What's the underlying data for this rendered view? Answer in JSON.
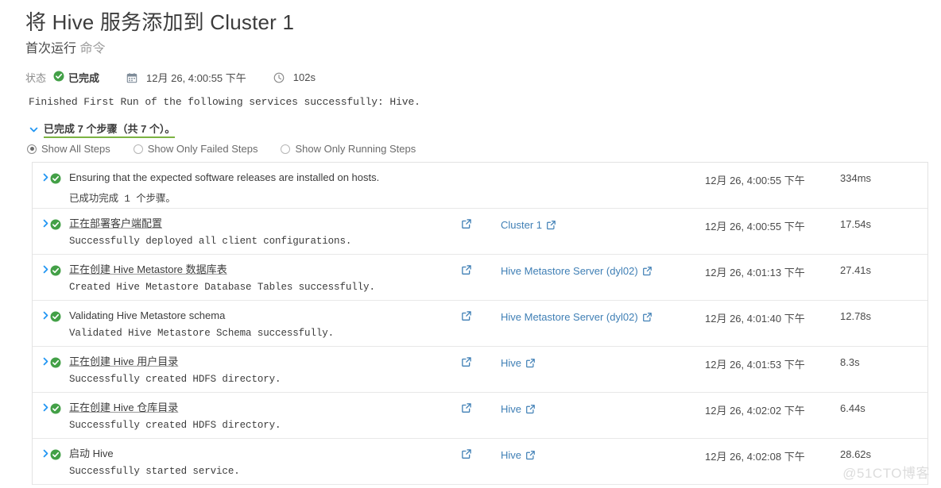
{
  "header": {
    "title": "将 Hive 服务添加到 Cluster 1",
    "subtitle_main": "首次运行",
    "subtitle_muted": "命令"
  },
  "status": {
    "label": "状态",
    "value": "已完成",
    "status_icon": "check-circle-icon",
    "calendar_icon": "calendar-icon",
    "timestamp": "12月 26, 4:00:55 下午",
    "clock_icon": "clock-icon",
    "duration": "102s",
    "status_color": "#43a047"
  },
  "run_message": "Finished First Run of the following services successfully: Hive.",
  "summary": {
    "toggle_icon": "chevron-down-icon",
    "text": "已完成 7 个步骤（共 7 个）。",
    "underline_color": "#7cb342"
  },
  "filters": [
    {
      "label": "Show All Steps",
      "selected": true
    },
    {
      "label": "Show Only Failed Steps",
      "selected": false
    },
    {
      "label": "Show Only Running Steps",
      "selected": false
    }
  ],
  "steps": [
    {
      "toggle_icon": "chevron-right-icon",
      "state_icon": "check-circle-icon",
      "title": "Ensuring that the expected software releases are installed on hosts.",
      "title_is_link": false,
      "detail": "已成功完成 1 个步骤。",
      "link_icon": "",
      "link_label": "",
      "time": "12月 26, 4:00:55 下午",
      "duration": "334ms"
    },
    {
      "toggle_icon": "chevron-right-icon",
      "state_icon": "check-circle-icon",
      "title": "正在部署客户端配置",
      "title_is_link": true,
      "detail": "Successfully deployed all client configurations.",
      "link_icon": "external-link-icon",
      "link_label": "Cluster 1",
      "time": "12月 26, 4:00:55 下午",
      "duration": "17.54s"
    },
    {
      "toggle_icon": "chevron-right-icon",
      "state_icon": "check-circle-icon",
      "title": "正在创建 Hive Metastore 数据库表",
      "title_is_link": true,
      "detail": "Created Hive Metastore Database Tables successfully.",
      "link_icon": "external-link-icon",
      "link_label": "Hive Metastore Server (dyl02)",
      "time": "12月 26, 4:01:13 下午",
      "duration": "27.41s"
    },
    {
      "toggle_icon": "chevron-right-icon",
      "state_icon": "check-circle-icon",
      "title": "Validating Hive Metastore schema",
      "title_is_link": false,
      "detail": "Validated Hive Metastore Schema successfully.",
      "link_icon": "external-link-icon",
      "link_label": "Hive Metastore Server (dyl02)",
      "time": "12月 26, 4:01:40 下午",
      "duration": "12.78s"
    },
    {
      "toggle_icon": "chevron-right-icon",
      "state_icon": "check-circle-icon",
      "title": "正在创建 Hive 用户目录",
      "title_is_link": true,
      "detail": "Successfully created HDFS directory.",
      "link_icon": "external-link-icon",
      "link_label": "Hive",
      "time": "12月 26, 4:01:53 下午",
      "duration": "8.3s"
    },
    {
      "toggle_icon": "chevron-right-icon",
      "state_icon": "check-circle-icon",
      "title": "正在创建 Hive 仓库目录",
      "title_is_link": true,
      "detail": "Successfully created HDFS directory.",
      "link_icon": "external-link-icon",
      "link_label": "Hive",
      "time": "12月 26, 4:02:02 下午",
      "duration": "6.44s"
    },
    {
      "toggle_icon": "chevron-right-icon",
      "state_icon": "check-circle-icon",
      "title": "启动 Hive",
      "title_is_link": false,
      "detail": "Successfully started service.",
      "link_icon": "external-link-icon",
      "link_label": "Hive",
      "time": "12月 26, 4:02:08 下午",
      "duration": "28.62s"
    }
  ],
  "watermark": "@51CTO博客"
}
